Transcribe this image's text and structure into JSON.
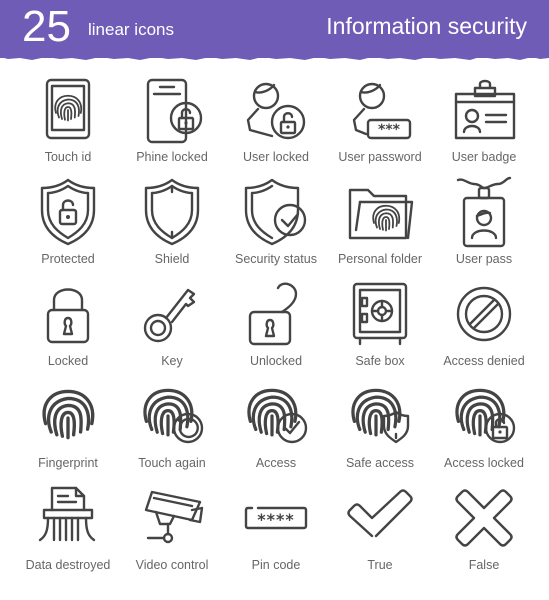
{
  "banner": {
    "count": "25",
    "subtitle": "linear icons",
    "title": "Information security",
    "color": "#6e5cb6"
  },
  "icon_color": "#444444",
  "label_color": "#666666",
  "icons": [
    {
      "label": "Touch id",
      "icon": "touch-id-icon"
    },
    {
      "label": "Phine locked",
      "icon": "phone-locked-icon"
    },
    {
      "label": "User locked",
      "icon": "user-locked-icon"
    },
    {
      "label": "User password",
      "icon": "user-password-icon"
    },
    {
      "label": "User badge",
      "icon": "user-badge-icon"
    },
    {
      "label": "Protected",
      "icon": "protected-icon"
    },
    {
      "label": "Shield",
      "icon": "shield-icon"
    },
    {
      "label": "Security status",
      "icon": "security-status-icon"
    },
    {
      "label": "Personal folder",
      "icon": "personal-folder-icon"
    },
    {
      "label": "User pass",
      "icon": "user-pass-icon"
    },
    {
      "label": "Locked",
      "icon": "locked-icon"
    },
    {
      "label": "Key",
      "icon": "key-icon"
    },
    {
      "label": "Unlocked",
      "icon": "unlocked-icon"
    },
    {
      "label": "Safe box",
      "icon": "safe-box-icon"
    },
    {
      "label": "Access denied",
      "icon": "access-denied-icon"
    },
    {
      "label": "Fingerprint",
      "icon": "fingerprint-icon"
    },
    {
      "label": "Touch again",
      "icon": "touch-again-icon"
    },
    {
      "label": "Access",
      "icon": "access-icon"
    },
    {
      "label": "Safe access",
      "icon": "safe-access-icon"
    },
    {
      "label": "Access locked",
      "icon": "access-locked-icon"
    },
    {
      "label": "Data destroyed",
      "icon": "data-destroyed-icon"
    },
    {
      "label": "Video control",
      "icon": "video-control-icon"
    },
    {
      "label": "Pin code",
      "icon": "pin-code-icon"
    },
    {
      "label": "True",
      "icon": "check-icon"
    },
    {
      "label": "False",
      "icon": "cross-icon"
    }
  ]
}
